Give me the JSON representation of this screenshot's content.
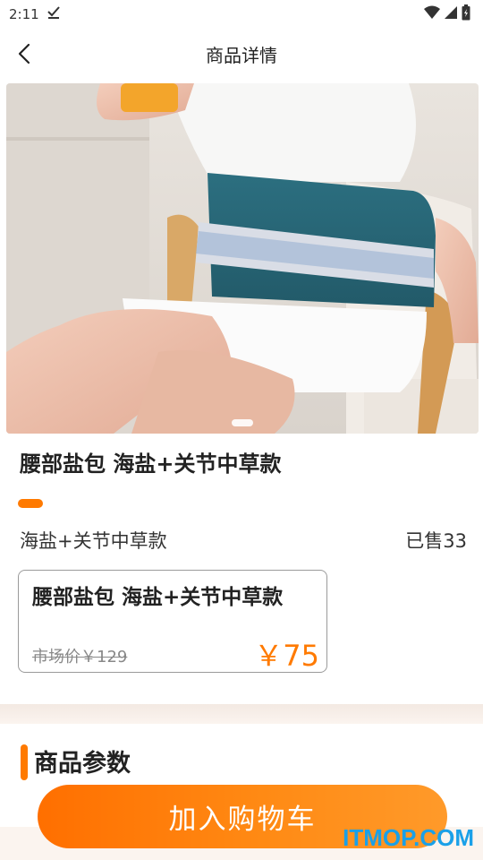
{
  "status_bar": {
    "time": "2:11",
    "icons": [
      "download-done-icon",
      "wifi-icon",
      "signal-icon",
      "battery-icon"
    ]
  },
  "header": {
    "title": "商品详情",
    "back_icon": "chevron-left-icon"
  },
  "product": {
    "title": "腰部盐包 海盐+关节中草款",
    "spec": "海盐+关节中草款",
    "sold": "已售33",
    "sku_name": "腰部盐包 海盐+关节中草款",
    "market_price": "市场价￥129",
    "sale_price": "￥75"
  },
  "params": {
    "title": "商品参数"
  },
  "actions": {
    "add_to_cart": "加入购物车"
  },
  "watermark": "ITMOP.COM",
  "colors": {
    "accent": "#ff7a00",
    "watermark": "#1aa0e8",
    "band": "#fbf4ef"
  }
}
